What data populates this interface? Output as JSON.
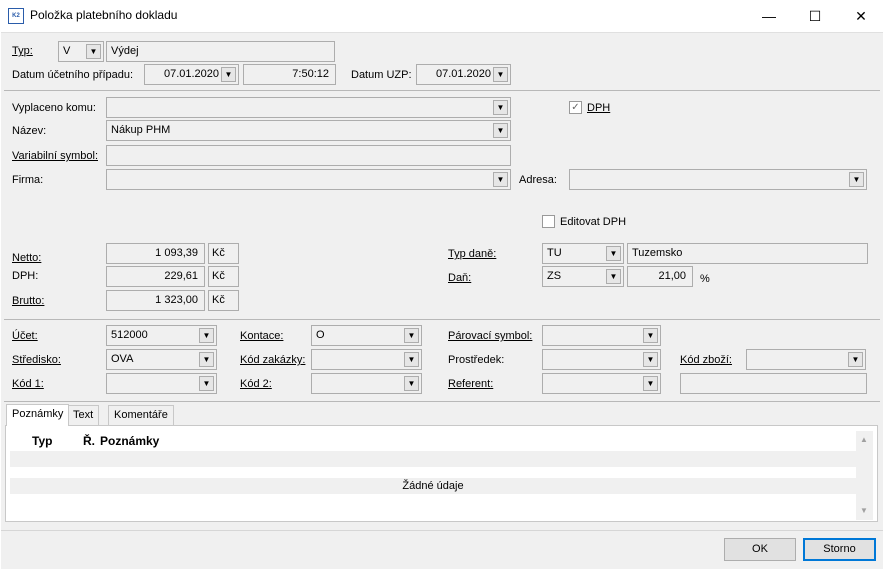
{
  "window": {
    "title": "Položka platebního dokladu",
    "icon_text": "K2",
    "minimize": "—",
    "maximize": "☐",
    "close": "✕"
  },
  "header": {
    "typ_label": "Typ:",
    "typ_code": "V",
    "typ_name": "Výdej",
    "datum_label": "Datum účetního případu:",
    "datum_value": "07.01.2020",
    "time_value": "7:50:12",
    "uzp_label": "Datum UZP:",
    "uzp_value": "07.01.2020"
  },
  "party": {
    "vyplaceno_label": "Vyplaceno komu:",
    "vyplaceno_value": "",
    "dph_label": "DPH",
    "dph_checked": true,
    "nazev_label": "Název:",
    "nazev_value": "Nákup PHM",
    "varsym_label": "Variabilní symbol:",
    "varsym_value": "",
    "firma_label": "Firma:",
    "firma_value": "",
    "adresa_label": "Adresa:",
    "adresa_value": "",
    "editovat_label": "Editovat DPH",
    "editovat_checked": false
  },
  "amounts": {
    "netto_label": "Netto:",
    "netto_value": "1 093,39",
    "dph_label": "DPH:",
    "dph_value": "229,61",
    "brutto_label": "Brutto:",
    "brutto_value": "1 323,00",
    "currency": "Kč",
    "typ_dane_label": "Typ daně:",
    "typ_dane_code": "TU",
    "typ_dane_name": "Tuzemsko",
    "dan_label": "Daň:",
    "dan_code": "ZS",
    "dan_rate": "21,00",
    "dan_unit": "%"
  },
  "accounting": {
    "ucet_label": "Účet:",
    "ucet_value": "512000",
    "kontace_label": "Kontace:",
    "kontace_value": "O",
    "parovaci_label": "Párovací symbol:",
    "parovaci_value": "",
    "stredisko_label": "Středisko:",
    "stredisko_value": "OVA",
    "zakazka_label": "Kód zakázky:",
    "zakazka_value": "",
    "prostredek_label": "Prostředek:",
    "prostredek_value": "",
    "zbozi_label": "Kód zboží:",
    "zbozi_value": "",
    "kod1_label": "Kód 1:",
    "kod1_value": "",
    "kod2_label": "Kód 2:",
    "kod2_value": "",
    "referent_label": "Referent:",
    "referent_value": "",
    "extra_value": ""
  },
  "tabs": [
    {
      "label": "Poznámky",
      "active": true
    },
    {
      "label": "Text",
      "active": false
    },
    {
      "label": "Komentáře",
      "active": false
    }
  ],
  "notes_grid": {
    "columns": [
      "Typ",
      "Ř.",
      "Poznámky"
    ],
    "empty_text": "Žádné údaje"
  },
  "buttons": {
    "ok": "OK",
    "cancel": "Storno"
  }
}
